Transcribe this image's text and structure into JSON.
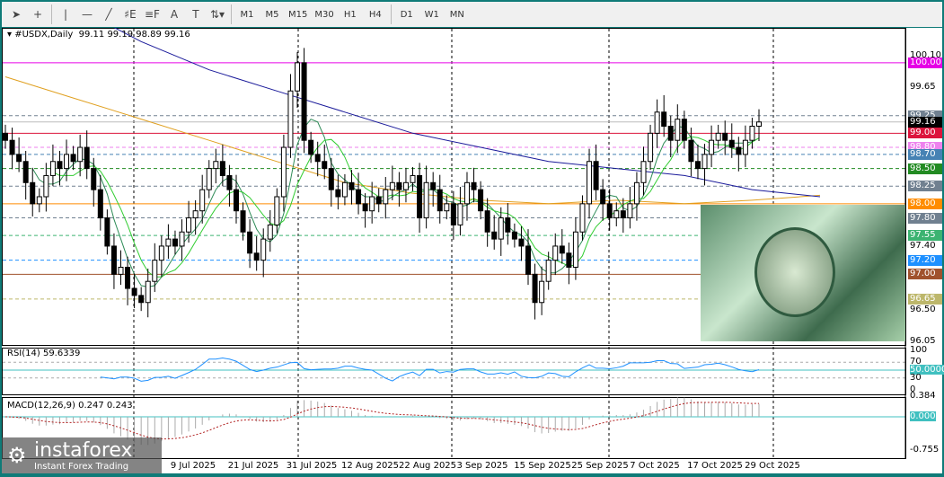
{
  "toolbar": {
    "tools": [
      {
        "name": "cursor-icon",
        "g": "➤"
      },
      {
        "name": "crosshair-icon",
        "g": "+"
      },
      {
        "name": "vertical-line-icon",
        "g": "|"
      },
      {
        "name": "horizontal-line-icon",
        "g": "—"
      },
      {
        "name": "trendline-icon",
        "g": "╱"
      },
      {
        "name": "fibonacci-icon",
        "g": "♯E"
      },
      {
        "name": "fibo-fan-icon",
        "g": "≡F"
      },
      {
        "name": "text-icon",
        "g": "A"
      },
      {
        "name": "text-label-icon",
        "g": "T"
      },
      {
        "name": "arrows-icon",
        "g": "⇅▾"
      }
    ],
    "timeframes": [
      "M1",
      "M5",
      "M15",
      "M30",
      "H1",
      "H4",
      "D1",
      "W1",
      "MN"
    ]
  },
  "chart": {
    "symbol_label": "#USDX,Daily",
    "ohlc": "99.11 99.19 98.89 99.16",
    "closes": [
      98.9,
      98.7,
      98.6,
      98.3,
      98.0,
      98.1,
      98.4,
      98.6,
      98.5,
      98.7,
      98.6,
      98.8,
      98.5,
      98.2,
      97.8,
      97.4,
      97.0,
      97.1,
      96.8,
      96.7,
      96.6,
      96.9,
      97.2,
      97.4,
      97.5,
      97.4,
      97.6,
      97.8,
      97.9,
      98.2,
      98.5,
      98.6,
      98.4,
      98.2,
      97.9,
      97.6,
      97.3,
      97.2,
      97.5,
      97.7,
      98.1,
      98.8,
      99.6,
      100.0,
      98.9,
      98.7,
      98.6,
      98.5,
      98.2,
      98.1,
      98.3,
      98.2,
      98.0,
      97.9,
      98.1,
      98.0,
      98.2,
      98.3,
      98.2,
      98.3,
      98.4,
      97.8,
      98.3,
      98.2,
      97.9,
      98.0,
      97.7,
      98.0,
      98.3,
      98.2,
      97.9,
      97.6,
      97.5,
      97.8,
      97.6,
      97.5,
      97.4,
      97.0,
      96.6,
      96.9,
      97.2,
      97.4,
      97.3,
      97.1,
      97.6,
      98.0,
      98.6,
      98.2,
      98.0,
      97.8,
      97.9,
      97.8,
      98.0,
      98.3,
      98.6,
      99.0,
      99.3,
      99.1,
      98.9,
      99.2,
      98.9,
      98.6,
      98.5,
      98.7,
      98.9,
      99.0,
      98.9,
      98.8,
      98.7,
      98.9,
      99.1,
      99.16
    ],
    "ma_blue_every10": [
      101.2,
      100.8,
      100.3,
      99.9,
      99.6,
      99.3,
      99.0,
      98.8,
      98.6,
      98.5,
      98.4,
      98.2,
      98.1
    ],
    "ma_orange_every10": [
      99.8,
      99.5,
      99.2,
      98.9,
      98.6,
      98.3,
      98.15,
      98.05,
      98.0,
      98.05,
      98.0,
      98.05,
      98.12
    ],
    "ylim": [
      96.0,
      100.5
    ],
    "levels": [
      {
        "price": "100.00",
        "color": "#e600e6",
        "style": "solid"
      },
      {
        "price": "99.25",
        "color": "#708090",
        "style": "dash"
      },
      {
        "price": "99.16",
        "color": "#000000",
        "style": "current"
      },
      {
        "price": "99.00",
        "color": "#dc143c",
        "style": "solid"
      },
      {
        "price": "98.80",
        "color": "#ee82ee",
        "style": "dash"
      },
      {
        "price": "98.70",
        "color": "#4682b4",
        "style": "dash"
      },
      {
        "price": "98.50",
        "color": "#228b22",
        "style": "dash"
      },
      {
        "price": "98.25",
        "color": "#708090",
        "style": "dash"
      },
      {
        "price": "98.00",
        "color": "#ff8c00",
        "style": "solid"
      },
      {
        "price": "97.80",
        "color": "#708090",
        "style": "dash"
      },
      {
        "price": "97.55",
        "color": "#3cb371",
        "style": "dash"
      },
      {
        "price": "97.20",
        "color": "#1e90ff",
        "style": "dash"
      },
      {
        "price": "97.00",
        "color": "#a0522d",
        "style": "solid"
      },
      {
        "price": "96.65",
        "color": "#bdb76b",
        "style": "dash"
      }
    ],
    "ticks": [
      "100.10",
      "99.65",
      "97.40",
      "96.50",
      "96.05"
    ]
  },
  "rsi": {
    "label": "RSI(14) 59.6339",
    "ticks": [
      "100",
      "70",
      "50.0000",
      "30",
      "0"
    ]
  },
  "macd": {
    "label": "MACD(12,26,9) 0.247 0.243",
    "ticks": [
      "0.384",
      "0.000",
      "-0.755"
    ]
  },
  "dates": [
    "9 Jul 2025",
    "21 Jul 2025",
    "31 Jul 2025",
    "12 Aug 2025",
    "22 Aug 2025",
    "3 Sep 2025",
    "15 Sep 2025",
    "25 Sep 2025",
    "7 Oct 2025",
    "17 Oct 2025",
    "29 Oct 2025"
  ],
  "logo": {
    "name": "instaforex",
    "slogan": "Instant Forex Trading"
  }
}
